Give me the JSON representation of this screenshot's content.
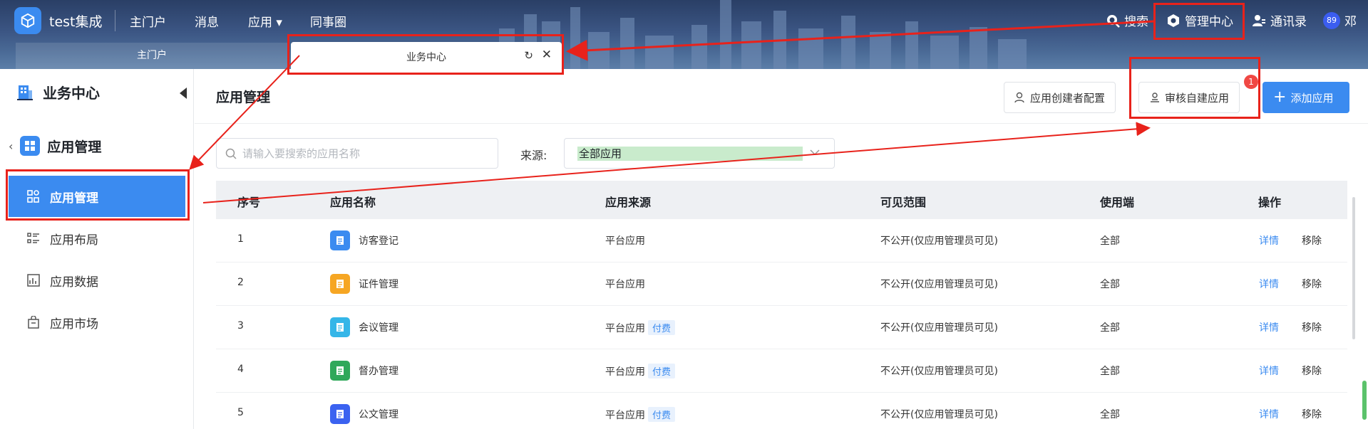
{
  "topbar": {
    "brand": "test集成",
    "nav": [
      "主门户",
      "消息",
      "应用 ▾",
      "同事圈"
    ],
    "subtab": "主门户",
    "search": "搜索",
    "admin": "管理中心",
    "contacts": "通讯录",
    "avatar_badge": "89",
    "user": "邓"
  },
  "float_tab": {
    "title": "业务中心"
  },
  "sidebar": {
    "title": "业务中心",
    "group": "应用管理",
    "items": [
      "应用管理",
      "应用布局",
      "应用数据",
      "应用市场"
    ]
  },
  "main": {
    "title": "应用管理",
    "btn_creator": "应用创建者配置",
    "btn_review": "审核自建应用",
    "review_badge": "1",
    "btn_add": "添加应用",
    "search_placeholder": "请输入要搜索的应用名称",
    "source_label": "来源:",
    "source_value": "全部应用"
  },
  "table": {
    "headers": [
      "序号",
      "应用名称",
      "应用来源",
      "可见范围",
      "使用端",
      "操作"
    ],
    "rows": [
      {
        "no": "1",
        "name": "访客登记",
        "source": "平台应用",
        "tag": "",
        "scope": "不公开(仅应用管理员可见)",
        "client": "全部",
        "detail": "详情",
        "remove": "移除",
        "icon_color": "#3b8bf0",
        "icon": "form-icon"
      },
      {
        "no": "2",
        "name": "证件管理",
        "source": "平台应用",
        "tag": "",
        "scope": "不公开(仅应用管理员可见)",
        "client": "全部",
        "detail": "详情",
        "remove": "移除",
        "icon_color": "#f6a623",
        "icon": "document-icon"
      },
      {
        "no": "3",
        "name": "会议管理",
        "source": "平台应用",
        "tag": "付费",
        "scope": "不公开(仅应用管理员可见)",
        "client": "全部",
        "detail": "详情",
        "remove": "移除",
        "icon_color": "#35b6e8",
        "icon": "meeting-icon"
      },
      {
        "no": "4",
        "name": "督办管理",
        "source": "平台应用",
        "tag": "付费",
        "scope": "不公开(仅应用管理员可见)",
        "client": "全部",
        "detail": "详情",
        "remove": "移除",
        "icon_color": "#2fa85a",
        "icon": "supervise-icon"
      },
      {
        "no": "5",
        "name": "公文管理",
        "source": "平台应用",
        "tag": "付费",
        "scope": "不公开(仅应用管理员可见)",
        "client": "全部",
        "detail": "详情",
        "remove": "移除",
        "icon_color": "#3b62f0",
        "icon": "official-doc-icon"
      }
    ]
  },
  "colors": {
    "accent": "#3b8bf0",
    "annotation": "#e8221b",
    "source_highlight": "#c9ebcc"
  }
}
